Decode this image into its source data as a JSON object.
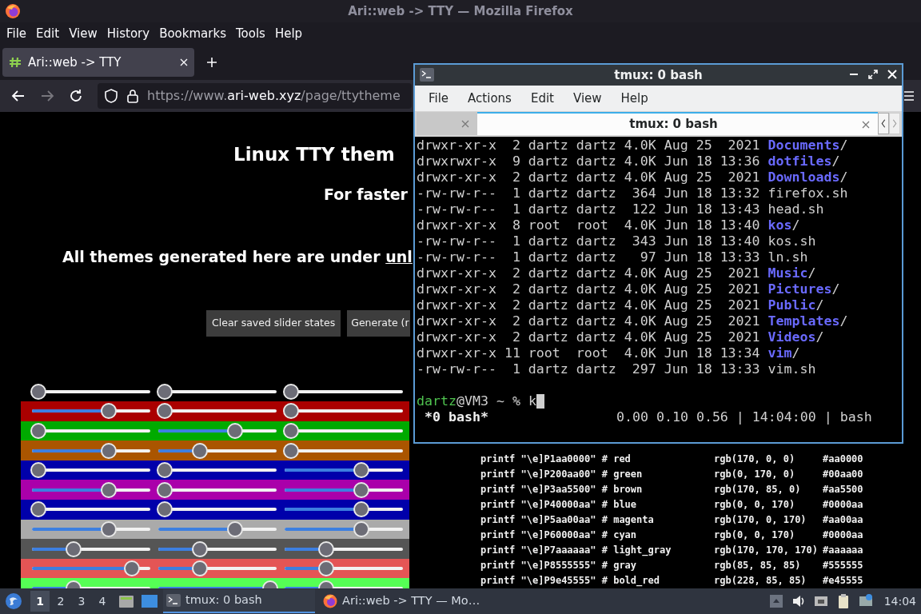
{
  "browser": {
    "title": "Ari::web -> TTY — Mozilla Firefox",
    "menu": [
      "File",
      "Edit",
      "View",
      "History",
      "Bookmarks",
      "Tools",
      "Help"
    ],
    "tabs": [
      {
        "title": "Ari::web -> TTY",
        "selected": true
      }
    ],
    "url": {
      "scheme": "https://www.",
      "domain": "ari-web.xyz",
      "path": "/page/ttytheme"
    }
  },
  "page": {
    "heading": "Linux TTY them",
    "subheading": "For faster",
    "license_text": "All themes generated here are under ",
    "license_link": "unl",
    "buttons": [
      "Clear saved slider states",
      "Generate (r"
    ],
    "slider_rows": [
      {
        "sliders": [
          {
            "level": 0
          },
          {
            "level": 0
          },
          {
            "level": 0
          }
        ]
      },
      {
        "color": "#aa0000",
        "sliders": [
          {
            "level": 0.67
          },
          {
            "level": 0
          },
          {
            "level": 0
          }
        ]
      },
      {
        "color": "#00aa00",
        "sliders": [
          {
            "level": 0
          },
          {
            "level": 0.67
          },
          {
            "level": 0
          }
        ]
      },
      {
        "color": "#aa5500",
        "sliders": [
          {
            "level": 0.67
          },
          {
            "level": 0.33
          },
          {
            "level": 0
          }
        ]
      },
      {
        "color": "#0000aa",
        "sliders": [
          {
            "level": 0
          },
          {
            "level": 0
          },
          {
            "level": 0.67
          }
        ]
      },
      {
        "color": "#aa00aa",
        "sliders": [
          {
            "level": 0.67
          },
          {
            "level": 0
          },
          {
            "level": 0.67
          }
        ]
      },
      {
        "color": "#0000aa",
        "sliders": [
          {
            "level": 0
          },
          {
            "level": 0
          },
          {
            "level": 0.67
          }
        ]
      },
      {
        "color": "#aaaaaa",
        "sliders": [
          {
            "level": 0.67
          },
          {
            "level": 0.67
          },
          {
            "level": 0.67
          }
        ]
      },
      {
        "color": "#555555",
        "sliders": [
          {
            "level": 0.33
          },
          {
            "level": 0.33
          },
          {
            "level": 0.33
          }
        ]
      },
      {
        "color": "#e45555",
        "sliders": [
          {
            "level": 0.89
          },
          {
            "level": 0.33
          },
          {
            "level": 0.33
          }
        ]
      },
      {
        "color": "#55ff55",
        "sliders": [
          {
            "level": 0.33
          },
          {
            "level": 1
          },
          {
            "level": 0.33
          }
        ]
      }
    ],
    "color_table": [
      {
        "command": "printf \"\\e]P1aa0000\" # red",
        "rgb": "rgb(170, 0, 0)",
        "hex": "#aa0000"
      },
      {
        "command": "printf \"\\e]P200aa00\" # green",
        "rgb": "rgb(0, 170, 0)",
        "hex": "#00aa00"
      },
      {
        "command": "printf \"\\e]P3aa5500\" # brown",
        "rgb": "rgb(170, 85, 0)",
        "hex": "#aa5500"
      },
      {
        "command": "printf \"\\e]P40000aa\" # blue",
        "rgb": "rgb(0, 0, 170)",
        "hex": "#0000aa"
      },
      {
        "command": "printf \"\\e]P5aa00aa\" # magenta",
        "rgb": "rgb(170, 0, 170)",
        "hex": "#aa00aa"
      },
      {
        "command": "printf \"\\e]P60000aa\" # cyan",
        "rgb": "rgb(0, 0, 170)",
        "hex": "#0000aa"
      },
      {
        "command": "printf \"\\e]P7aaaaaa\" # light_gray",
        "rgb": "rgb(170, 170, 170)",
        "hex": "#aaaaaa"
      },
      {
        "command": "printf \"\\e]P8555555\" # gray",
        "rgb": "rgb(85, 85, 85)",
        "hex": "#555555"
      },
      {
        "command": "printf \"\\e]P9e45555\" # bold_red",
        "rgb": "rgb(228, 85, 85)",
        "hex": "#e45555"
      }
    ]
  },
  "terminal": {
    "title": "tmux: 0 bash",
    "menu": [
      "File",
      "Actions",
      "Edit",
      "View",
      "Help"
    ],
    "tabs": [
      {
        "selected": false
      },
      {
        "title": "tmux: 0 bash",
        "selected": true
      }
    ],
    "lines": [
      {
        "kind": "dir",
        "info": "drwxr-xr-x  2 dartz dartz 4.0K Aug 25  2021 ",
        "name": "Documents",
        "suffix": "/"
      },
      {
        "kind": "dir",
        "info": "drwxrwxr-x  9 dartz dartz 4.0K Jun 18 13:36 ",
        "name": "dotfiles",
        "suffix": "/"
      },
      {
        "kind": "dir",
        "info": "drwxr-xr-x  2 dartz dartz 4.0K Aug 25  2021 ",
        "name": "Downloads",
        "suffix": "/"
      },
      {
        "kind": "file",
        "info": "-rw-rw-r--  1 dartz dartz  364 Jun 18 13:32 ",
        "name": "firefox.sh"
      },
      {
        "kind": "file",
        "info": "-rw-rw-r--  1 dartz dartz  122 Jun 18 13:43 ",
        "name": "head.sh"
      },
      {
        "kind": "dir",
        "info": "drwxr-xr-x  8 root  root  4.0K Jun 18 13:40 ",
        "name": "kos",
        "suffix": "/"
      },
      {
        "kind": "file",
        "info": "-rw-rw-r--  1 dartz dartz  343 Jun 18 13:40 ",
        "name": "kos.sh"
      },
      {
        "kind": "file",
        "info": "-rw-rw-r--  1 dartz dartz   97 Jun 18 13:33 ",
        "name": "ln.sh"
      },
      {
        "kind": "dir",
        "info": "drwxr-xr-x  2 dartz dartz 4.0K Aug 25  2021 ",
        "name": "Music",
        "suffix": "/"
      },
      {
        "kind": "dir",
        "info": "drwxr-xr-x  2 dartz dartz 4.0K Aug 25  2021 ",
        "name": "Pictures",
        "suffix": "/"
      },
      {
        "kind": "dir",
        "info": "drwxr-xr-x  2 dartz dartz 4.0K Aug 25  2021 ",
        "name": "Public",
        "suffix": "/"
      },
      {
        "kind": "dir",
        "info": "drwxr-xr-x  2 dartz dartz 4.0K Aug 25  2021 ",
        "name": "Templates",
        "suffix": "/"
      },
      {
        "kind": "dir",
        "info": "drwxr-xr-x  2 dartz dartz 4.0K Aug 25  2021 ",
        "name": "Videos",
        "suffix": "/"
      },
      {
        "kind": "dir",
        "info": "drwxr-xr-x 11 root  root  4.0K Jun 18 13:34 ",
        "name": "vim",
        "suffix": "/"
      },
      {
        "kind": "file",
        "info": "-rw-rw-r--  1 dartz dartz  297 Jun 18 13:33 ",
        "name": "vim.sh"
      }
    ],
    "prompt": {
      "user": "dartz",
      "rest": "@VM3 ~ % ",
      "input": "k"
    },
    "status": {
      "window": "*0 bash*",
      "info": "0.00 0.10 0.56 | 14:04:00 | bash"
    }
  },
  "taskbar": {
    "workspaces": [
      {
        "label": "1",
        "selected": true
      },
      {
        "label": "2",
        "selected": false
      },
      {
        "label": "3",
        "selected": false
      },
      {
        "label": "4",
        "selected": false
      }
    ],
    "tasks": [
      {
        "kind": "terminal",
        "title": "tmux: 0 bash",
        "selected": true
      },
      {
        "kind": "firefox",
        "title": "Ari::web -> TTY — Mo…",
        "selected": false
      }
    ],
    "clock": "14:04"
  }
}
